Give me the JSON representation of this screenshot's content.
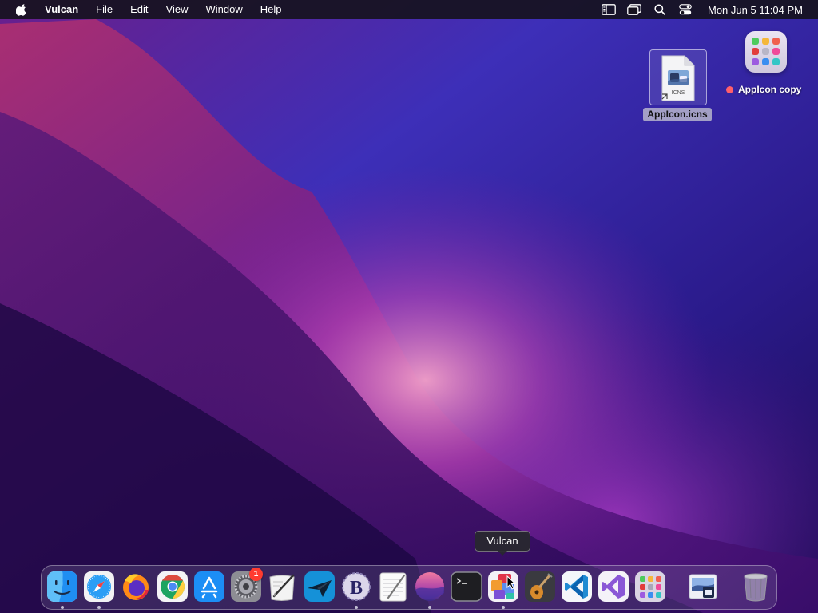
{
  "menubar": {
    "apple_icon": "apple-logo-icon",
    "app_name": "Vulcan",
    "menus": [
      "File",
      "Edit",
      "View",
      "Window",
      "Help"
    ],
    "status_icons": [
      "reading-list-icon",
      "screen-mirroring-icon",
      "spotlight-search-icon",
      "control-center-icon"
    ],
    "clock": "Mon Jun 5  11:04 PM"
  },
  "desktop": {
    "files": [
      {
        "label": "AppIcon.icns",
        "badge_text": "ICNS",
        "selected": true,
        "is_alias": true
      },
      {
        "label": "AppIcon copy",
        "tag_color": "#ff5f6b"
      }
    ]
  },
  "dock": {
    "tooltip": "Vulcan",
    "apps": [
      {
        "name": "Finder",
        "icon": "finder-icon",
        "running": true
      },
      {
        "name": "Safari",
        "icon": "safari-icon",
        "running": true
      },
      {
        "name": "Firefox",
        "icon": "firefox-icon",
        "running": false
      },
      {
        "name": "Google Chrome",
        "icon": "chrome-icon",
        "running": false
      },
      {
        "name": "App Store",
        "icon": "app-store-icon",
        "running": false
      },
      {
        "name": "System Settings",
        "icon": "system-settings-icon",
        "running": false,
        "badge": "1"
      },
      {
        "name": "Script Editor",
        "icon": "script-editor-icon",
        "running": false
      },
      {
        "name": "Transmit",
        "icon": "transmit-icon",
        "running": false
      },
      {
        "name": "BBEdit",
        "icon": "bbedit-icon",
        "running": true
      },
      {
        "name": "TextEdit",
        "icon": "textedit-icon",
        "running": false
      },
      {
        "name": "Monterey Wallpaper",
        "icon": "wallpaper-app-icon",
        "running": true
      },
      {
        "name": "Terminal",
        "icon": "terminal-icon",
        "running": false
      },
      {
        "name": "Vulcan",
        "icon": "vulcan-icon",
        "running": true
      },
      {
        "name": "Instruments",
        "icon": "instruments-icon",
        "running": false
      },
      {
        "name": "Visual Studio Code",
        "icon": "vscode-icon",
        "running": false
      },
      {
        "name": "Visual Studio",
        "icon": "visual-studio-icon",
        "running": false
      },
      {
        "name": "Launchpad",
        "icon": "launchpad-icon",
        "running": false
      },
      {
        "name": "Preview",
        "icon": "preview-document-icon",
        "running": false
      },
      {
        "name": "Trash",
        "icon": "trash-icon",
        "running": false
      }
    ]
  },
  "colors": {
    "wallpaper_base": "#2a0b63",
    "wallpaper_glow": "#e86aa8",
    "badge": "#ff3b30"
  }
}
